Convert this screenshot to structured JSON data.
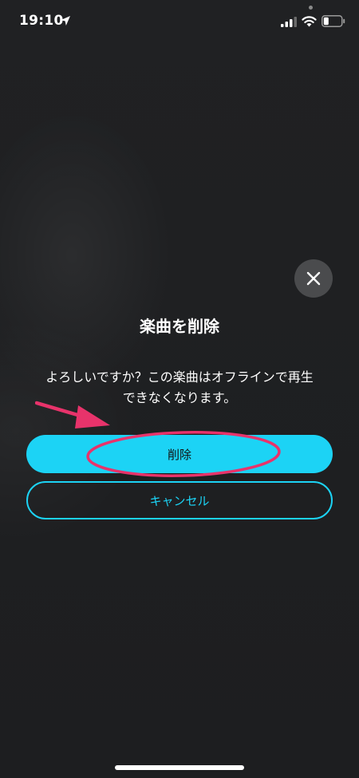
{
  "status_bar": {
    "time": "19:10",
    "icons": [
      "location-arrow-icon",
      "cellular-signal-icon",
      "wifi-icon",
      "battery-icon"
    ]
  },
  "dialog": {
    "title": "楽曲を削除",
    "message_line1": "よろしいですか？この楽曲はオフラインで再生",
    "message_line2": "できなくなります。",
    "close_icon": "close-icon",
    "delete_label": "削除",
    "cancel_label": "キャンセル"
  },
  "colors": {
    "accent": "#1cd3f5",
    "background": "#1f2022",
    "close_button_bg": "#4a4b4d",
    "annotation": "#e8336b"
  }
}
